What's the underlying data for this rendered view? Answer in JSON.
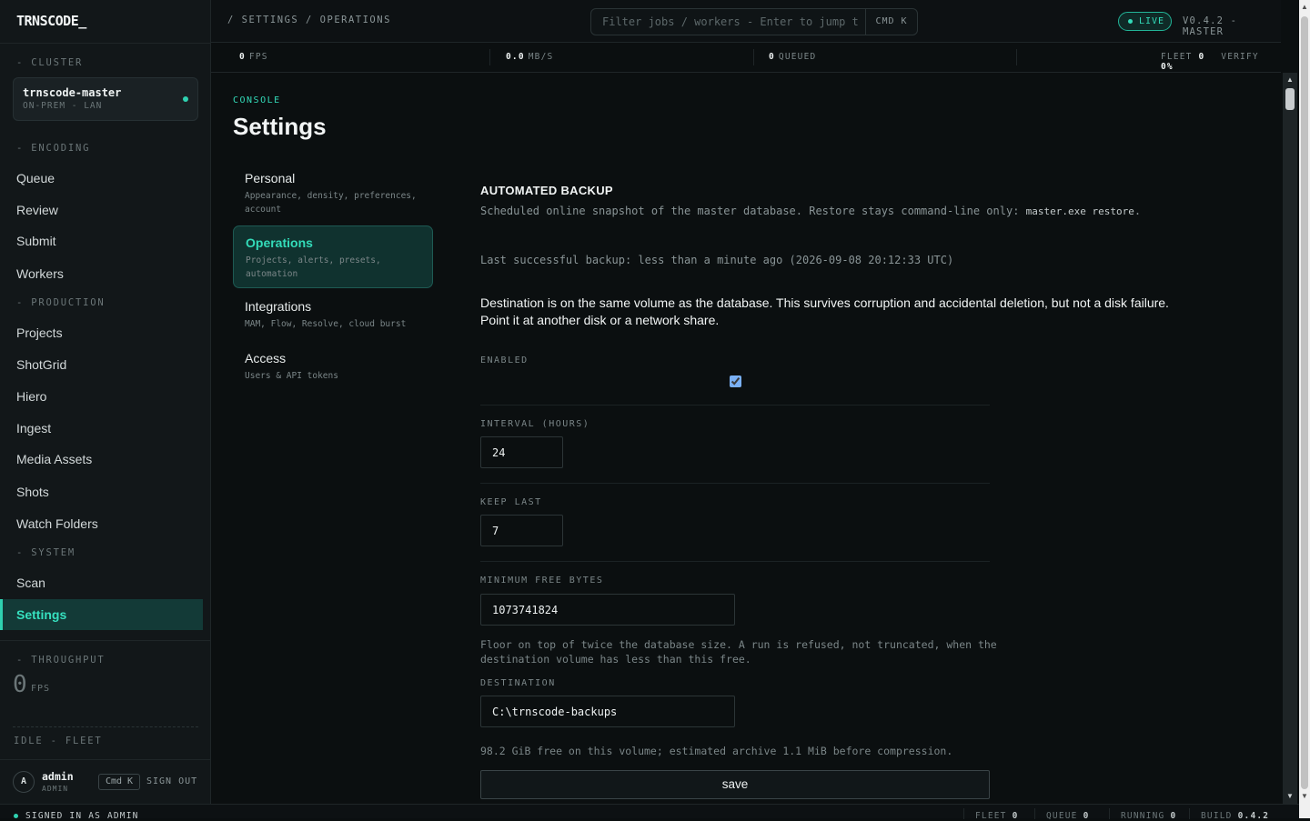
{
  "app": {
    "logo": "TRNSCODE_"
  },
  "sidebar": {
    "cluster_label": "- CLUSTER",
    "cluster_name": "trnscode-master",
    "cluster_sub": "ON-PREM - LAN",
    "encoding_label": "- ENCODING",
    "encoding_items": [
      "Queue",
      "Review",
      "Submit",
      "Workers"
    ],
    "production_label": "- PRODUCTION",
    "production_items": [
      "Projects",
      "ShotGrid",
      "Hiero",
      "Ingest",
      "Media Assets",
      "Shots",
      "Watch Folders"
    ],
    "system_label": "- SYSTEM",
    "system_items": [
      "Scan",
      "Settings"
    ],
    "active_item": "Settings",
    "throughput_label": "- THROUGHPUT",
    "throughput_value": "0",
    "throughput_unit": "FPS",
    "idle_fleet": "IDLE - FLEET",
    "user": {
      "avatar": "A",
      "name": "admin",
      "role": "ADMIN"
    },
    "cmdk_chip": "Cmd K",
    "sign_out": "SIGN OUT"
  },
  "topbar": {
    "breadcrumb": "/ SETTINGS / OPERATIONS",
    "search_placeholder": "Filter jobs / workers - Enter to jump t",
    "search_kbd": "CMD K",
    "live": "LIVE",
    "version": "V0.4.2 - MASTER"
  },
  "stats": {
    "fps_value": "0",
    "fps_unit": "FPS",
    "mbs_value": "0.0",
    "mbs_unit": "MB/S",
    "queued_value": "0",
    "queued_unit": "QUEUED",
    "fleet_label": "FLEET",
    "fleet_value": "0",
    "verify_label": "VERIFY",
    "verify_value": "0%"
  },
  "page": {
    "eyebrow": "CONSOLE",
    "title": "Settings",
    "nav": [
      {
        "title": "Personal",
        "desc": "Appearance, density, preferences, account"
      },
      {
        "title": "Operations",
        "desc": "Projects, alerts, presets, automation"
      },
      {
        "title": "Integrations",
        "desc": "MAM, Flow, Resolve, cloud burst"
      },
      {
        "title": "Access",
        "desc": "Users & API tokens"
      }
    ],
    "active_nav": "Operations"
  },
  "backup": {
    "title": "AUTOMATED BACKUP",
    "desc": "Scheduled online snapshot of the master database. Restore stays command-line only:",
    "desc_code": "master.exe restore",
    "desc_end": ".",
    "last_backup": "Last successful backup: less than a minute ago (2026-09-08 20:12:33 UTC)",
    "warning": "Destination is on the same volume as the database. This survives corruption and accidental deletion, but not a disk failure. Point it at another disk or a network share.",
    "enabled_label": "ENABLED",
    "enabled": true,
    "interval_label": "INTERVAL (HOURS)",
    "interval_value": "24",
    "keep_last_label": "KEEP LAST",
    "keep_last_value": "7",
    "min_free_label": "MINIMUM FREE BYTES",
    "min_free_value": "1073741824",
    "min_free_help": "Floor on top of twice the database size. A run is refused, not truncated, when the destination volume has less than this free.",
    "destination_label": "DESTINATION",
    "destination_value": "C:\\trnscode-backups",
    "destination_help": "98.2 GiB free on this volume; estimated archive 1.1 MiB before compression.",
    "save_label": "save"
  },
  "footer": {
    "signed_in": "SIGNED IN AS ADMIN",
    "fleet_label": "FLEET",
    "fleet_value": "0",
    "queue_label": "QUEUE",
    "queue_value": "0",
    "running_label": "RUNNING",
    "running_value": "0",
    "build_label": "BUILD",
    "build_value": "0.4.2"
  },
  "colors": {
    "accent": "#2fd1b0",
    "background": "#0b0f10",
    "sidebar": "#121719",
    "active_bg": "#133a37"
  }
}
